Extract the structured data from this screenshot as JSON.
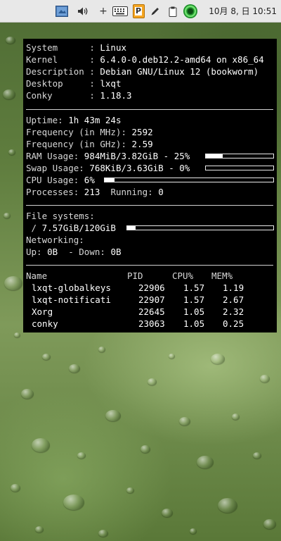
{
  "taskbar": {
    "clock": "10月 8, 日 10:51",
    "plus_label": "+",
    "pdf_label": "P"
  },
  "conky": {
    "system": [
      {
        "label": "System     ",
        "value": "Linux"
      },
      {
        "label": "Kernel     ",
        "value": "6.4.0-0.deb12.2-amd64 on x86_64"
      },
      {
        "label": "Description",
        "value": "Debian GNU/Linux 12 (bookworm)"
      },
      {
        "label": "Desktop    ",
        "value": "lxqt"
      },
      {
        "label": "Conky      ",
        "value": "1.18.3"
      }
    ],
    "uptime_label": "Uptime:",
    "uptime": "1h 43m 24s",
    "freq_mhz_label": "Frequency (in MHz):",
    "freq_mhz": "2592",
    "freq_ghz_label": "Frequency (in GHz):",
    "freq_ghz": "2.59",
    "ram_label": "RAM Usage:",
    "ram_value": "984MiB/3.82GiB - 25%",
    "ram_pct": 25,
    "swap_label": "Swap Usage:",
    "swap_value": "768KiB/3.63GiB - 0%",
    "swap_pct": 0,
    "cpu_label": "CPU Usage:",
    "cpu_value": "6%",
    "cpu_pct": 6,
    "processes_label": "Processes:",
    "processes": "213",
    "running_label": "Running:",
    "running": "0",
    "fs_heading": "File systems:",
    "fs_root_label": " /",
    "fs_root_value": "7.57GiB/120GiB",
    "fs_root_pct": 6,
    "net_heading": "Networking:",
    "up_label": "Up:",
    "up_value": "0B",
    "down_label": "- Down:",
    "down_value": "0B",
    "proc_headers": {
      "name": "Name",
      "pid": "PID",
      "cpu": "CPU%",
      "mem": "MEM%"
    },
    "procs": [
      {
        "name": "lxqt-globalkeys",
        "pid": "22906",
        "cpu": "1.57",
        "mem": "1.19"
      },
      {
        "name": "lxqt-notificati",
        "pid": "22907",
        "cpu": "1.57",
        "mem": "2.67"
      },
      {
        "name": "Xorg",
        "pid": "22645",
        "cpu": "1.05",
        "mem": "2.32"
      },
      {
        "name": "conky",
        "pid": "23063",
        "cpu": "1.05",
        "mem": "0.25"
      }
    ]
  }
}
